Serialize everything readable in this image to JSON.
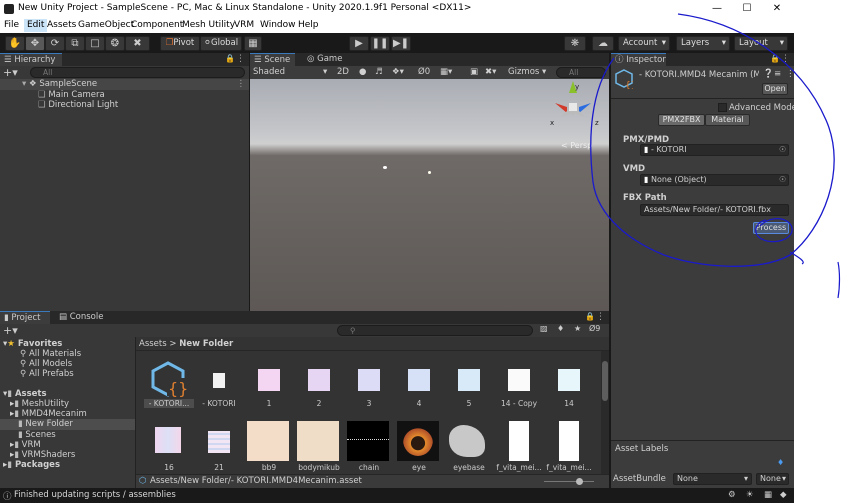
{
  "window": {
    "title": "New Unity Project - SampleScene - PC, Mac & Linux Standalone - Unity 2020.1.9f1 Personal <DX11>"
  },
  "menu": [
    "File",
    "Edit",
    "Assets",
    "GameObject",
    "Component",
    "Mesh Utility",
    "VRM",
    "Window",
    "Help"
  ],
  "toolbar": {
    "pivot": "Pivot",
    "global": "Global",
    "account": "Account",
    "layers": "Layers",
    "layout": "Layout"
  },
  "hierarchy": {
    "tab": "Hierarchy",
    "search_placeholder": "All",
    "scene": "SampleScene",
    "items": [
      "Main Camera",
      "Directional Light"
    ]
  },
  "scene_view": {
    "tabs": [
      "Scene",
      "Game"
    ],
    "shading": "Shaded",
    "mode_2d": "2D",
    "hidden_count": "0",
    "gizmos": "Gizmos",
    "search_placeholder": "All",
    "persp": "< Persp",
    "gizmo_axes": {
      "x": "x",
      "y": "y",
      "z": "z"
    }
  },
  "inspector": {
    "tab": "Inspector",
    "object_name": "- KOTORI.MMD4 Mecanim (M",
    "open": "Open",
    "advanced_mode": "Advanced Mode",
    "tabs": [
      "PMX2FBX",
      "Material"
    ],
    "pmx_label": "PMX/PMD",
    "pmx_value": "- KOTORI",
    "vmd_label": "VMD",
    "vmd_value": "None (Object)",
    "fbx_label": "FBX Path",
    "fbx_value": "Assets/New Folder/- KOTORI.fbx",
    "process": "Process",
    "asset_labels": "Asset Labels",
    "asset_bundle_label": "AssetBundle",
    "asset_bundle_value": "None",
    "asset_bundle_variant": "None"
  },
  "project": {
    "tabs": [
      "Project",
      "Console"
    ],
    "favorites_label": "Favorites",
    "favorites": [
      "All Materials",
      "All Models",
      "All Prefabs"
    ],
    "assets_label": "Assets",
    "assets_children": [
      "MeshUtility",
      "MMD4Mecanim",
      "New Folder",
      "Scenes",
      "VRM",
      "VRMShaders"
    ],
    "packages_label": "Packages",
    "breadcrumb": [
      "Assets",
      "New Folder"
    ],
    "hidden_count": "9",
    "grid_row1": [
      "- KOTORI...",
      "- KOTORI",
      "1",
      "2",
      "3",
      "4",
      "5",
      "14 - Copy",
      "14"
    ],
    "grid_row2": [
      "16",
      "21",
      "bb9",
      "bodymikub",
      "chain",
      "eye",
      "eyebase",
      "f_vita_mei...",
      "f_vita_mei..."
    ],
    "footer_path": "Assets/New Folder/- KOTORI.MMD4Mecanim.asset"
  },
  "status": {
    "text": "Finished updating scripts / assemblies"
  },
  "colors": {
    "accent_blue": "#3a79bb",
    "selection": "#2c5d87",
    "annotation": "#1a1acc",
    "sky": "#b9bcc4",
    "ground": "#5d5855"
  }
}
